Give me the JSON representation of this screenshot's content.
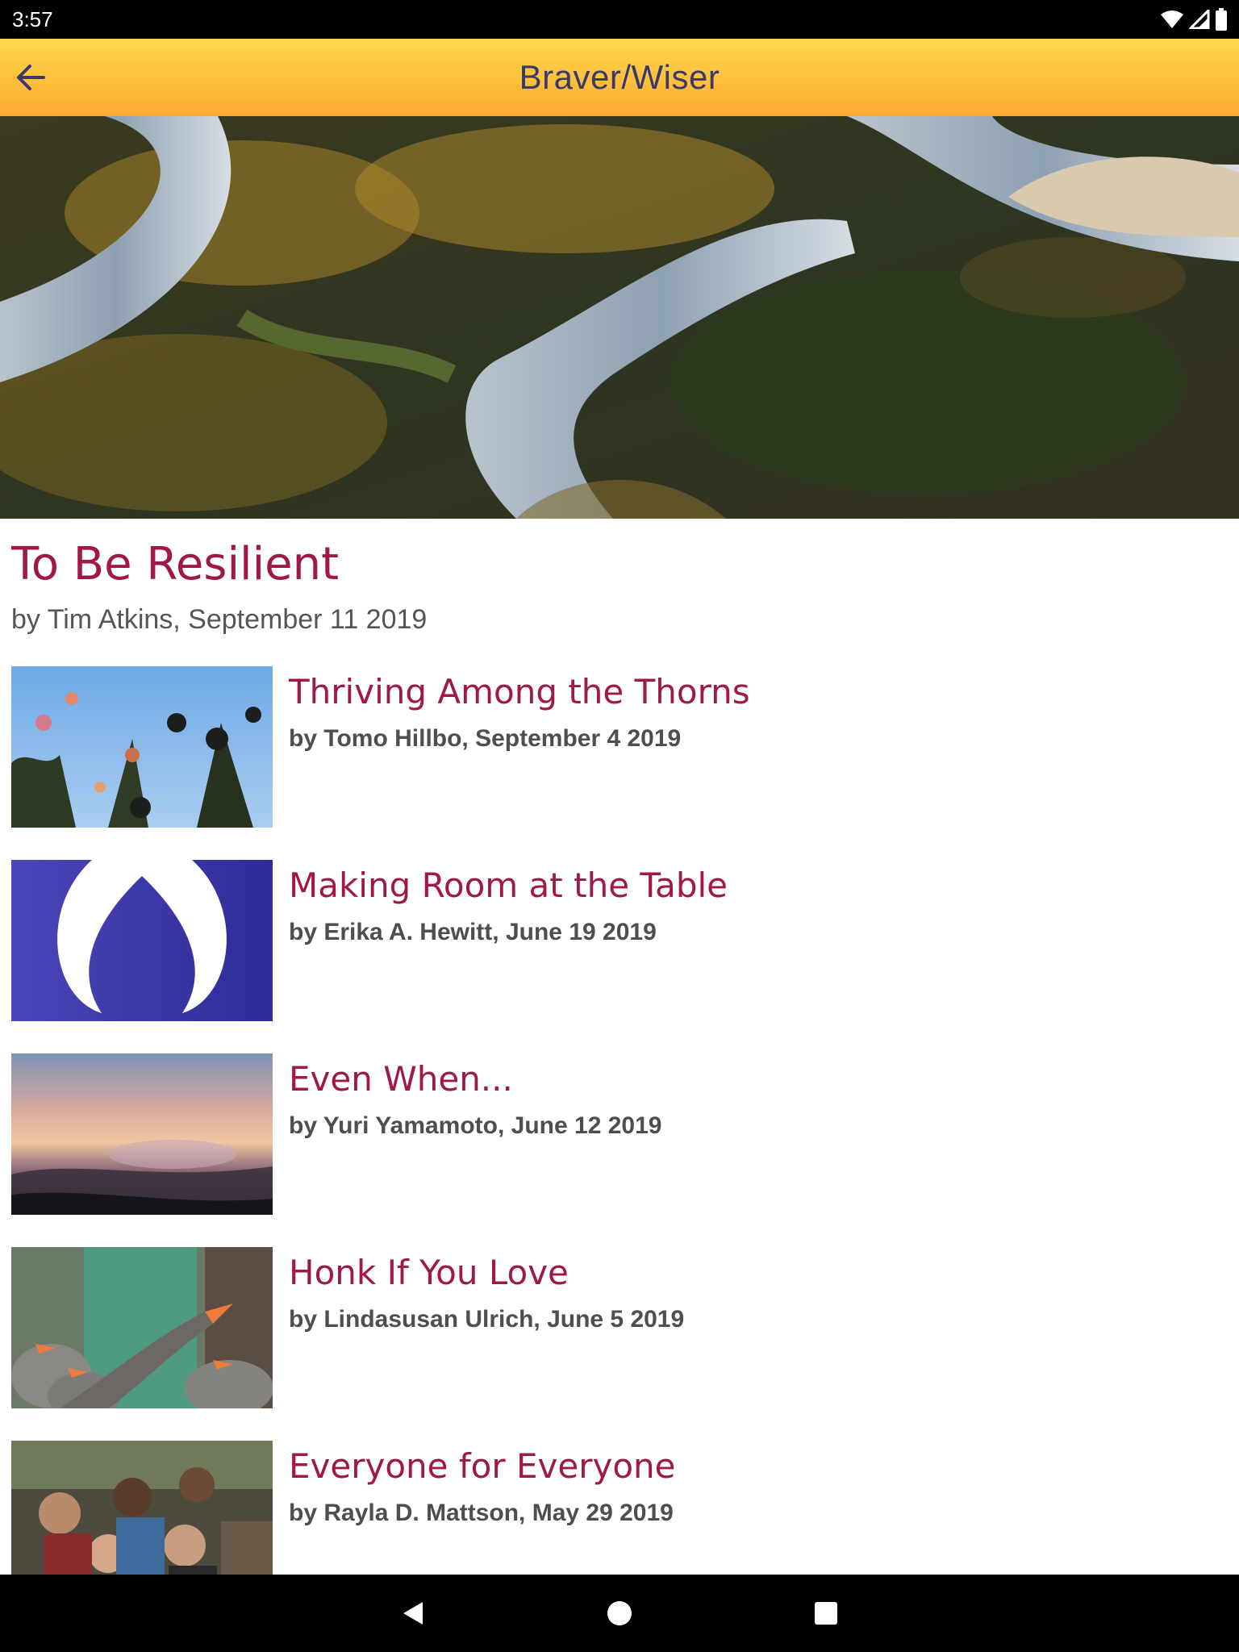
{
  "status_bar": {
    "time": "3:57",
    "icons": [
      "wifi-icon",
      "cell-signal-icon",
      "battery-icon"
    ]
  },
  "app_bar": {
    "title": "Braver/Wiser",
    "back_icon": "arrow-back-icon",
    "colors": {
      "top": "#ffd84e",
      "bottom": "#f9a932",
      "title": "#3a3a6a"
    }
  },
  "featured": {
    "title": "To Be Resilient",
    "byline": "by Tim Atkins, September 11 2019",
    "image": "aerial river forest photo"
  },
  "articles": [
    {
      "title": "Thriving Among the Thorns",
      "byline": "by Tomo Hillbo, September 4 2019",
      "thumb": "thistle flowers against blue sky"
    },
    {
      "title": "Making Room at the Table",
      "byline": "by Erika A. Hewitt, June 19 2019",
      "thumb": "chalice flame logo"
    },
    {
      "title": "Even When...",
      "byline": "by Yuri Yamamoto, June 12 2019",
      "thumb": "sunset above clouds"
    },
    {
      "title": "Honk If You Love",
      "byline": "by Lindasusan Ulrich, June 5 2019",
      "thumb": "honking geese"
    },
    {
      "title": "Everyone for Everyone",
      "byline": "by Rayla D. Mattson, May 29 2019",
      "thumb": "crowd of cheering people"
    }
  ],
  "nav_bar": {
    "buttons": [
      "back-triangle-icon",
      "home-circle-icon",
      "recents-square-icon"
    ]
  },
  "colors": {
    "accent_title": "#a0184a",
    "byline": "#555555",
    "status_bar": "#000000",
    "nav_bar": "#000000"
  }
}
